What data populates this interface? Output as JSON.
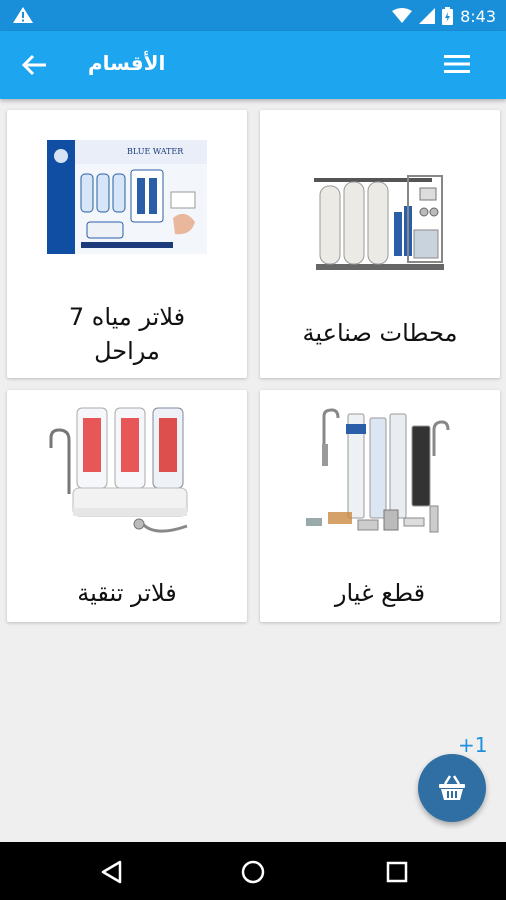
{
  "status_bar": {
    "time": "8:43",
    "icons": [
      "warning-icon",
      "wifi-icon",
      "signal-icon",
      "battery-icon"
    ]
  },
  "app_bar": {
    "title": "الأقسام",
    "back_icon": "arrow-back-icon",
    "menu_icon": "hamburger-menu-icon"
  },
  "categories": [
    {
      "label": "محطات صناعية",
      "image": "industrial-ro-station"
    },
    {
      "label": "فلاتر مياه 7 مراحل",
      "image": "seven-stage-filter-box"
    },
    {
      "label": "قطع غيار",
      "image": "spare-parts"
    },
    {
      "label": "فلاتر تنقية",
      "image": "purification-filters"
    }
  ],
  "cart": {
    "badge": "+1",
    "icon": "basket-icon"
  },
  "colors": {
    "status_bar": "#1a8fd9",
    "app_bar": "#1ea5f0",
    "fab": "#2f6fa4",
    "badge": "#1e90e0",
    "background": "#efefef"
  },
  "nav_bar": {
    "icons": [
      "back-triangle-icon",
      "home-circle-icon",
      "recents-square-icon"
    ]
  }
}
